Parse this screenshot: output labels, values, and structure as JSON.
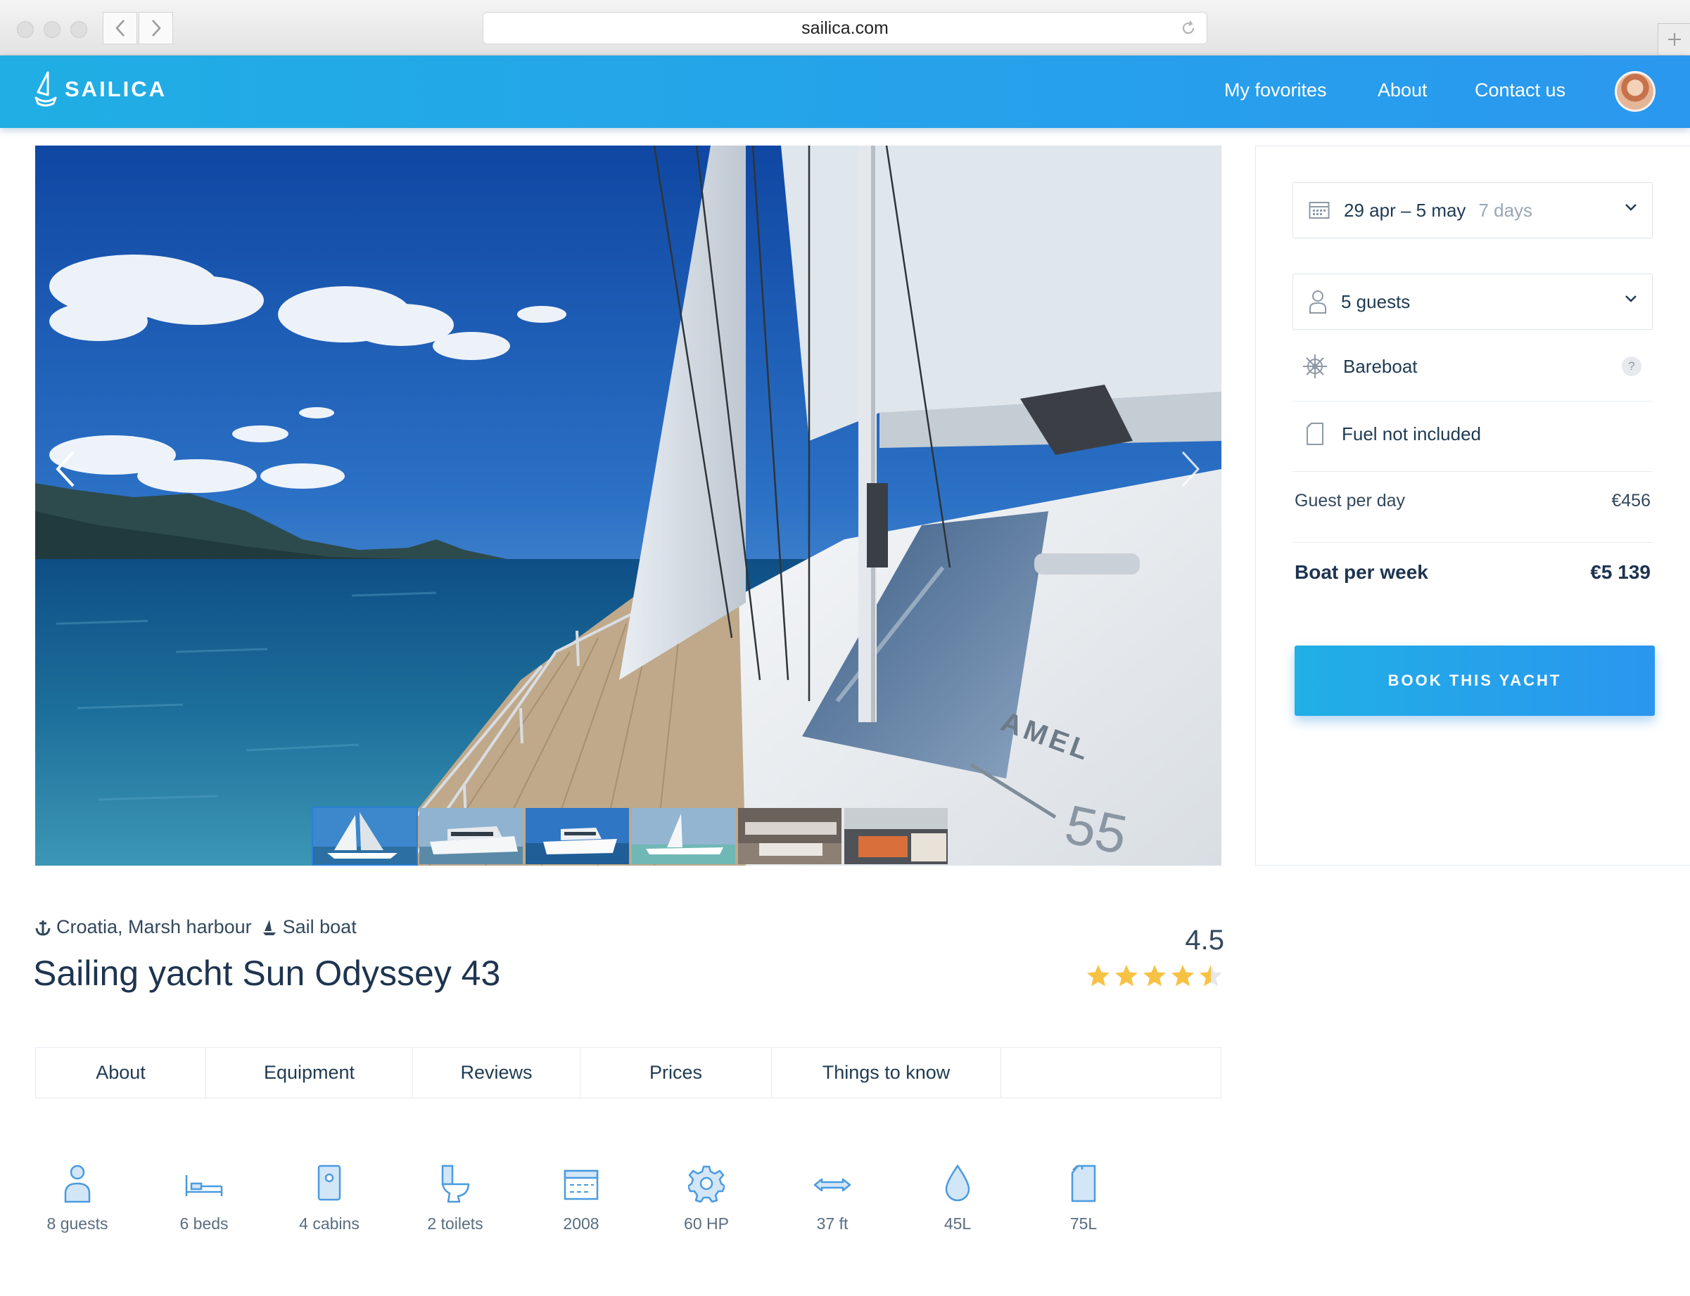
{
  "browser": {
    "url": "sailica.com"
  },
  "brand": {
    "name": "SAILICA",
    "accent": "#2a9cec"
  },
  "nav": {
    "favorites": "My fovorites",
    "about": "About",
    "contact": "Contact us"
  },
  "booking": {
    "dates": "29 apr – 5 may",
    "duration": "7 days",
    "guests": "5 guests",
    "charter_type": "Bareboat",
    "help": "?",
    "fuel": "Fuel not included",
    "guest_per_day_label": "Guest per day",
    "guest_per_day_value": "€456",
    "boat_per_week_label": "Boat per week",
    "boat_per_week_value": "€5 139",
    "book_button": "BOOK THIS YACHT"
  },
  "boat": {
    "location": "Croatia, Marsh harbour",
    "type": "Sail boat",
    "title": "Sailing yacht Sun Odyssey 43",
    "rating": "4.5",
    "rating_value": 4.5,
    "rating_max": 5,
    "hull_text": "AMEL",
    "hull_number": "55"
  },
  "tabs": [
    "About",
    "Equipment",
    "Reviews",
    "Prices",
    "Things to know"
  ],
  "features": [
    {
      "icon": "person-icon",
      "label": "8 guests"
    },
    {
      "icon": "bed-icon",
      "label": "6 beds"
    },
    {
      "icon": "cabin-door-icon",
      "label": "4 cabins"
    },
    {
      "icon": "toilet-icon",
      "label": "2 toilets"
    },
    {
      "icon": "calendar-icon",
      "label": "2008"
    },
    {
      "icon": "gear-icon",
      "label": "60 HP"
    },
    {
      "icon": "length-arrows-icon",
      "label": "37 ft"
    },
    {
      "icon": "water-drop-icon",
      "label": "45L"
    },
    {
      "icon": "fuel-canister-icon",
      "label": "75L"
    }
  ]
}
